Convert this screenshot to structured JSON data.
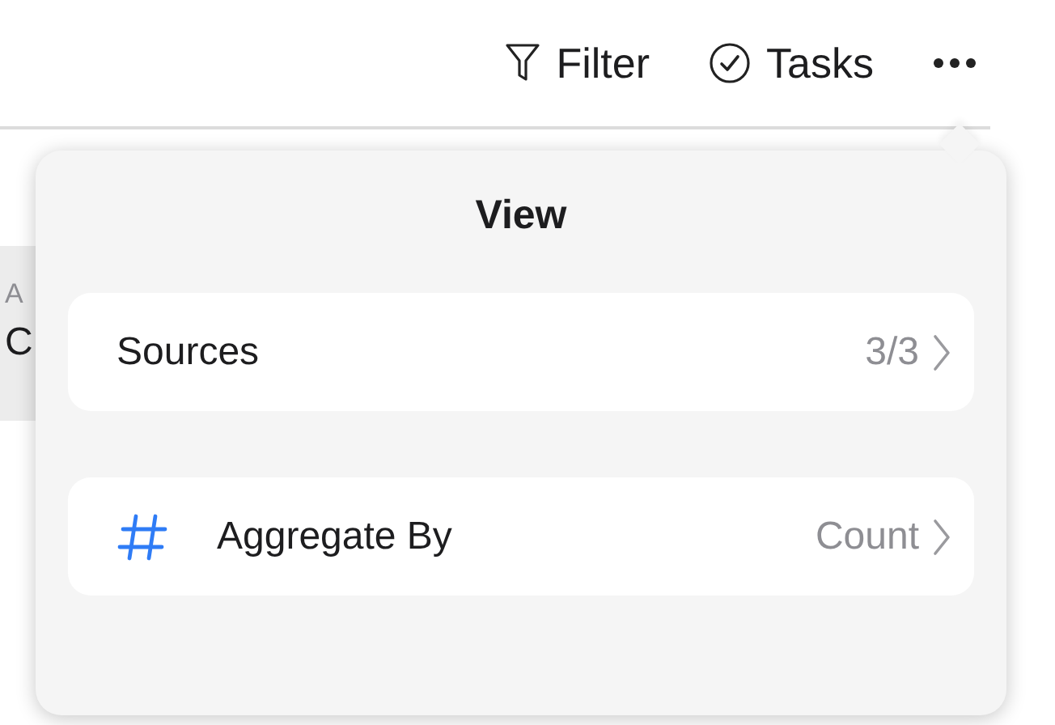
{
  "toolbar": {
    "buttons": [
      {
        "kind": "filter",
        "label": "Filter"
      },
      {
        "kind": "tasks",
        "label": "Tasks"
      },
      {
        "kind": "more"
      }
    ]
  },
  "background_item": {
    "caption": "A",
    "value": "C"
  },
  "popover": {
    "title": "View",
    "rows": [
      {
        "kind": "plain",
        "label": "Sources",
        "value": "3/3"
      },
      {
        "kind": "hash",
        "label": "Aggregate By",
        "value": "Count"
      }
    ]
  }
}
